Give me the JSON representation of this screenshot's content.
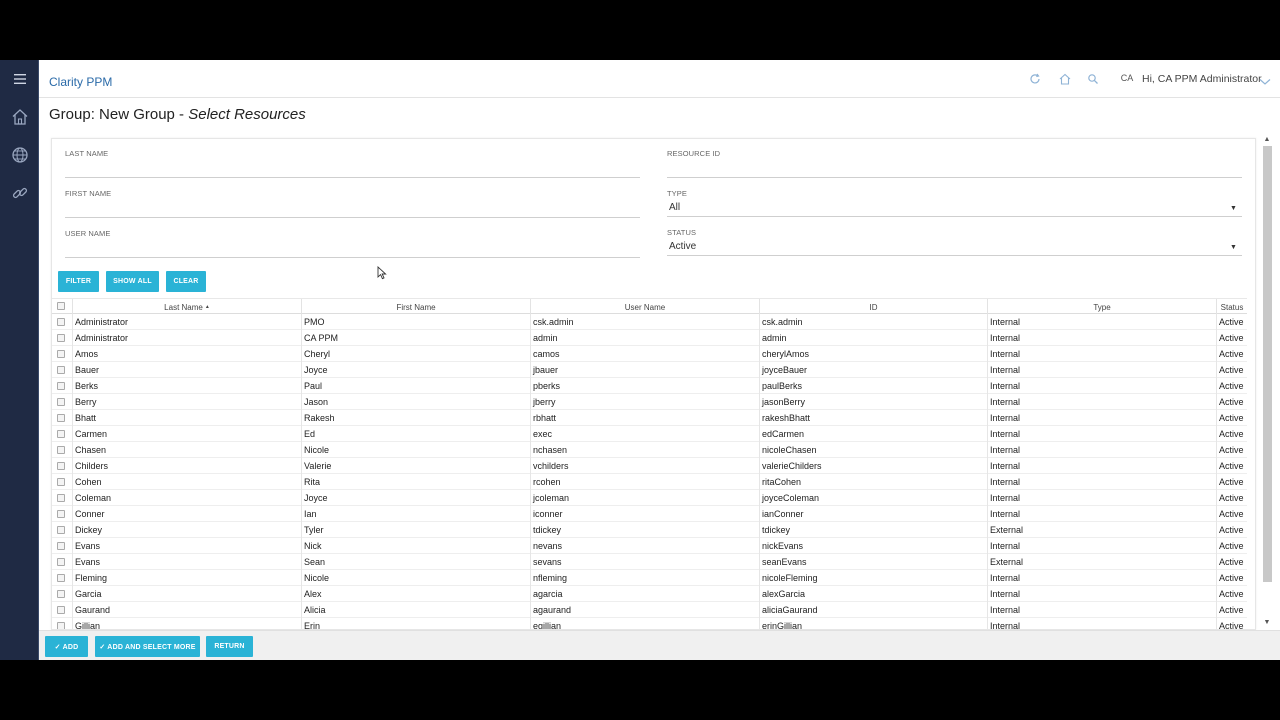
{
  "app": {
    "title": "Clarity PPM"
  },
  "topbar": {
    "avatar_initials": "CA",
    "user_greeting": "Hi, CA PPM Administrator"
  },
  "icons": {
    "menu": "hamburger-icon",
    "home": "home-icon",
    "globe": "globe-icon",
    "link": "link-icon",
    "refresh": "refresh-icon",
    "search": "search-icon",
    "chevron": "chevron-down-icon"
  },
  "page": {
    "title_prefix": "Group: New Group - ",
    "title_emphasis": "Select Resources"
  },
  "filters": {
    "last_name_label": "LAST NAME",
    "first_name_label": "FIRST NAME",
    "user_name_label": "USER NAME",
    "resource_id_label": "RESOURCE ID",
    "type_label": "TYPE",
    "type_value": "All",
    "status_label": "STATUS",
    "status_value": "Active",
    "filter_button": "FILTER",
    "show_all_button": "SHOW ALL",
    "clear_button": "CLEAR"
  },
  "grid": {
    "columns": [
      "Last Name",
      "First Name",
      "User Name",
      "ID",
      "Type",
      "Status"
    ],
    "sort_indicator": "▲",
    "rows": [
      [
        "Administrator",
        "PMO",
        "csk.admin",
        "csk.admin",
        "Internal",
        "Active"
      ],
      [
        "Administrator",
        "CA PPM",
        "admin",
        "admin",
        "Internal",
        "Active"
      ],
      [
        "Amos",
        "Cheryl",
        "camos",
        "cherylAmos",
        "Internal",
        "Active"
      ],
      [
        "Bauer",
        "Joyce",
        "jbauer",
        "joyceBauer",
        "Internal",
        "Active"
      ],
      [
        "Berks",
        "Paul",
        "pberks",
        "paulBerks",
        "Internal",
        "Active"
      ],
      [
        "Berry",
        "Jason",
        "jberry",
        "jasonBerry",
        "Internal",
        "Active"
      ],
      [
        "Bhatt",
        "Rakesh",
        "rbhatt",
        "rakeshBhatt",
        "Internal",
        "Active"
      ],
      [
        "Carmen",
        "Ed",
        "exec",
        "edCarmen",
        "Internal",
        "Active"
      ],
      [
        "Chasen",
        "Nicole",
        "nchasen",
        "nicoleChasen",
        "Internal",
        "Active"
      ],
      [
        "Childers",
        "Valerie",
        "vchilders",
        "valerieChilders",
        "Internal",
        "Active"
      ],
      [
        "Cohen",
        "Rita",
        "rcohen",
        "ritaCohen",
        "Internal",
        "Active"
      ],
      [
        "Coleman",
        "Joyce",
        "jcoleman",
        "joyceColeman",
        "Internal",
        "Active"
      ],
      [
        "Conner",
        "Ian",
        "iconner",
        "ianConner",
        "Internal",
        "Active"
      ],
      [
        "Dickey",
        "Tyler",
        "tdickey",
        "tdickey",
        "External",
        "Active"
      ],
      [
        "Evans",
        "Nick",
        "nevans",
        "nickEvans",
        "Internal",
        "Active"
      ],
      [
        "Evans",
        "Sean",
        "sevans",
        "seanEvans",
        "External",
        "Active"
      ],
      [
        "Fleming",
        "Nicole",
        "nfleming",
        "nicoleFleming",
        "Internal",
        "Active"
      ],
      [
        "Garcia",
        "Alex",
        "agarcia",
        "alexGarcia",
        "Internal",
        "Active"
      ],
      [
        "Gaurand",
        "Alicia",
        "agaurand",
        "aliciaGaurand",
        "Internal",
        "Active"
      ],
      [
        "Gillian",
        "Erin",
        "egillian",
        "erinGillian",
        "Internal",
        "Active"
      ]
    ]
  },
  "footer": {
    "add_button": "✓ ADD",
    "add_select_more_button": "✓ ADD AND SELECT MORE",
    "return_button": "RETURN"
  },
  "colors": {
    "nav_bg": "#1f2a44",
    "accent": "#2ab3d6",
    "link": "#2a6aa8"
  }
}
